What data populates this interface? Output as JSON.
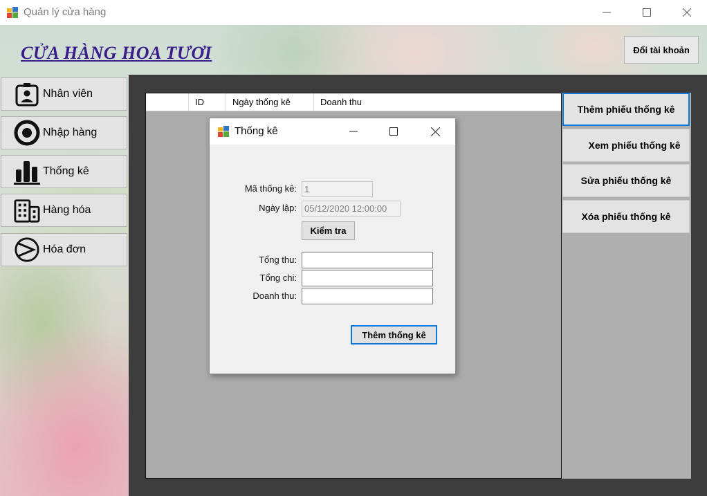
{
  "window": {
    "title": "Quản lý cửa hàng"
  },
  "header": {
    "shop_title": "CỬA HÀNG HOA TƯƠI",
    "account_button": "Đổi tài khoản"
  },
  "sidebar": {
    "items": [
      {
        "label": "Nhân viên",
        "icon": "employee-badge-icon"
      },
      {
        "label": "Nhập hàng",
        "icon": "import-circle-icon"
      },
      {
        "label": "Thống kê",
        "icon": "bar-chart-icon"
      },
      {
        "label": "Hàng hóa",
        "icon": "building-icon"
      },
      {
        "label": "Hóa đơn",
        "icon": "invoice-play-icon"
      }
    ]
  },
  "grid": {
    "columns": [
      "",
      "ID",
      "Ngày thống kê",
      "Doanh thu"
    ]
  },
  "actions": {
    "add": "Thêm phiếu thống kê",
    "view": "Xem phiếu thống kê",
    "edit": "Sửa phiếu thống kê",
    "delete": "Xóa phiếu thống kê"
  },
  "dialog": {
    "title": "Thống kê",
    "id_label": "Mã thống kê:",
    "id_value": "1",
    "date_label": "Ngày lập:",
    "date_value": "05/12/2020 12:00:00",
    "check_button": "Kiểm tra",
    "income_label": "Tổng thu:",
    "income_value": "",
    "expense_label": "Tổng chi:",
    "expense_value": "",
    "revenue_label": "Doanh thu:",
    "revenue_value": "",
    "submit_button": "Thêm thống kê"
  },
  "colors": {
    "accent": "#0a78d7",
    "title": "#3a1d8a",
    "panel": "#3c3c3c",
    "grid_bg": "#ababab"
  }
}
